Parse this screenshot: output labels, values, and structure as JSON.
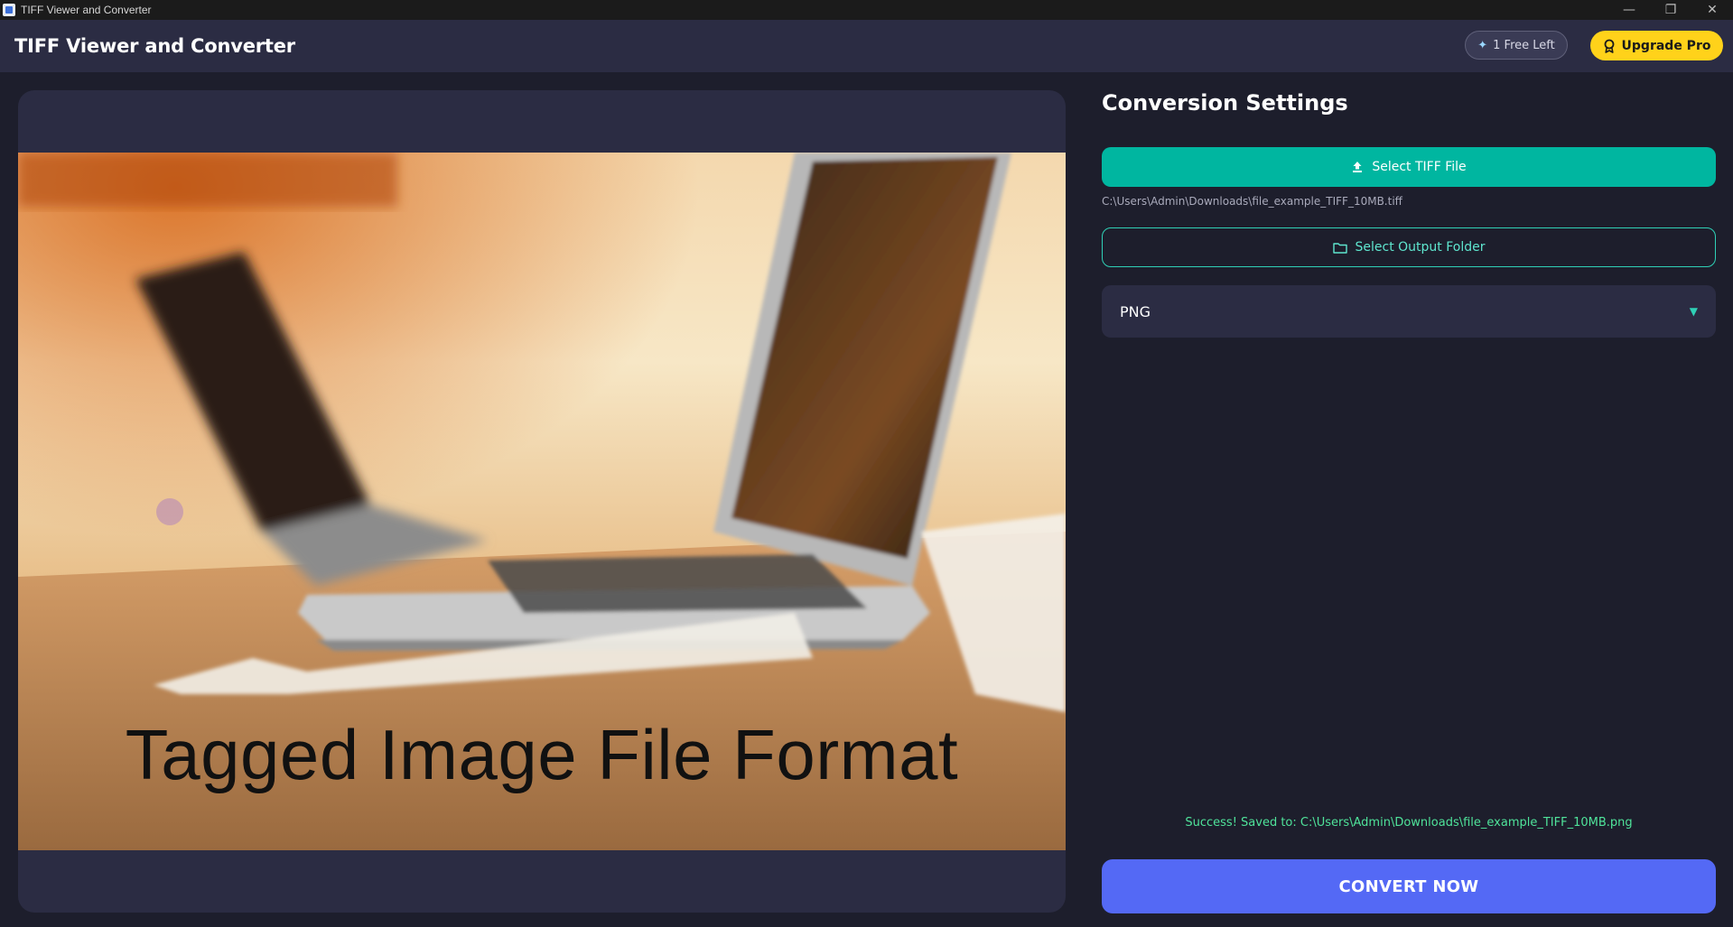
{
  "window": {
    "title": "TIFF Viewer and Converter",
    "controls": {
      "minimize": "—",
      "restore": "❐",
      "close": "✕"
    }
  },
  "header": {
    "app_title": "TIFF Viewer and Converter",
    "free_badge": {
      "label": "1 Free Left",
      "icon": "sparkle-icon"
    },
    "upgrade": {
      "label": "Upgrade Pro",
      "icon": "award-icon"
    }
  },
  "preview": {
    "image_caption": "Tagged Image File Format"
  },
  "settings": {
    "title": "Conversion Settings",
    "select_tiff_label": "Select TIFF File",
    "select_tiff_icon": "upload-icon",
    "file_path": "C:\\Users\\Admin\\Downloads\\file_example_TIFF_10MB.tiff",
    "select_output_label": "Select Output Folder",
    "select_output_icon": "folder-icon",
    "format": {
      "selected": "PNG"
    },
    "success_message": "Success! Saved to: C:\\Users\\Admin\\Downloads\\file_example_TIFF_10MB.png",
    "convert_label": "CONVERT NOW"
  },
  "colors": {
    "background": "#1d1e2c",
    "panel": "#2b2c43",
    "teal": "#00b6a0",
    "accent_yellow": "#ffd21a",
    "convert_blue": "#5469f5",
    "success_green": "#4fe39a"
  }
}
